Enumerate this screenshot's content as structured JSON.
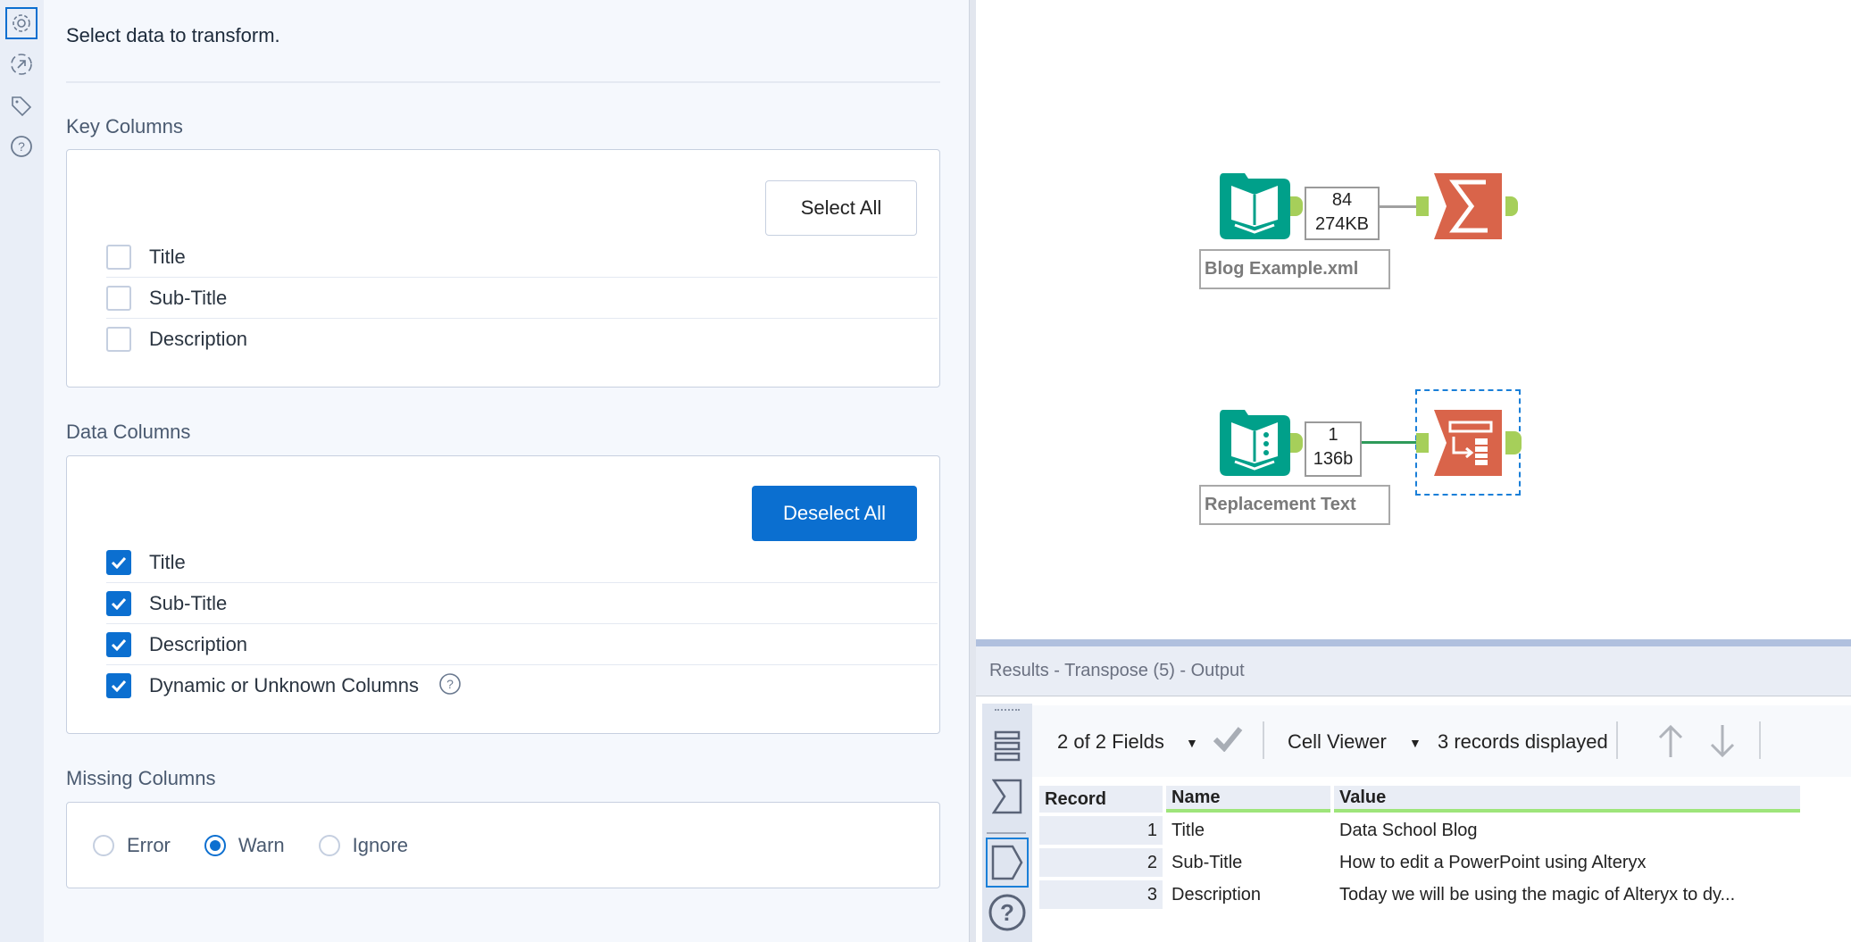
{
  "side_icons": [
    "gear-icon",
    "connection-icon",
    "tag-icon",
    "help-icon"
  ],
  "config": {
    "intro": "Select data to transform.",
    "key_columns": {
      "title": "Key Columns",
      "button": "Select All",
      "items": [
        {
          "label": "Title",
          "checked": false
        },
        {
          "label": "Sub-Title",
          "checked": false
        },
        {
          "label": "Description",
          "checked": false
        }
      ]
    },
    "data_columns": {
      "title": "Data Columns",
      "button": "Deselect All",
      "items": [
        {
          "label": "Title",
          "checked": true
        },
        {
          "label": "Sub-Title",
          "checked": true
        },
        {
          "label": "Description",
          "checked": true
        },
        {
          "label": "Dynamic or Unknown Columns",
          "checked": true
        }
      ]
    },
    "missing_columns": {
      "title": "Missing Columns",
      "options": [
        "Error",
        "Warn",
        "Ignore"
      ],
      "selected": "Warn"
    }
  },
  "canvas": {
    "tools": [
      {
        "label": "Blog Example.xml",
        "count": "84",
        "size": "274KB",
        "next": "Summarize"
      },
      {
        "label": "Replacement Text",
        "count": "1",
        "size": "136b",
        "next": "Transpose"
      }
    ]
  },
  "results": {
    "title": "Results - Transpose (5) - Output",
    "fields": "2 of 2 Fields",
    "viewer": "Cell Viewer",
    "records": "3 records displayed",
    "columns": [
      "Record",
      "Name",
      "Value"
    ],
    "rows": [
      [
        "1",
        "Title",
        "Data School Blog"
      ],
      [
        "2",
        "Sub-Title",
        "How to edit a PowerPoint using Alteryx"
      ],
      [
        "3",
        "Description",
        "Today we will be using the magic of Alteryx to dy..."
      ]
    ]
  },
  "colors": {
    "accent": "#0b6fd0",
    "input_tool": "#00a08a",
    "transform_tool": "#d9644a",
    "anchor": "#a6cf5a"
  }
}
